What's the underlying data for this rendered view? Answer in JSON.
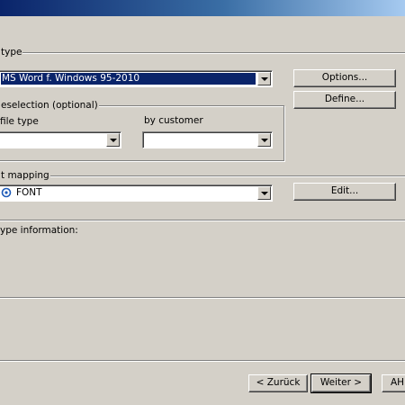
{
  "title": "",
  "file_type": {
    "group_label": "type",
    "selected": "MS Word f. Windows 95-2010",
    "options_button": "Options...",
    "define_button": "Define..."
  },
  "preselection": {
    "group_label": "eselection (optional)",
    "file_type_label": "file type",
    "file_type_value": "",
    "customer_label": "by customer",
    "customer_value": ""
  },
  "mapping": {
    "group_label": "t mapping",
    "selected": "FONT",
    "edit_button": "Edit..."
  },
  "info": {
    "label": "ype information:"
  },
  "footer": {
    "back_button": "< Zurück",
    "next_button": "Weiter >",
    "cancel_button": "AH"
  }
}
